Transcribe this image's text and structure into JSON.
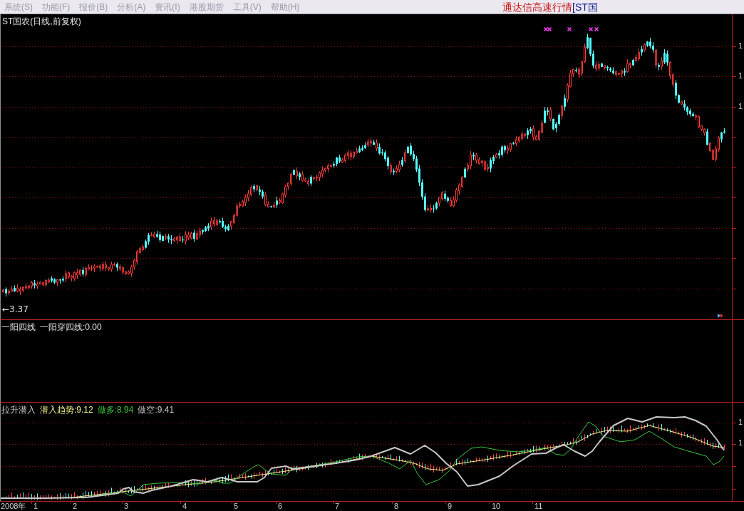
{
  "menu_bar": {
    "items": [
      "系统(S)",
      "功能(F)",
      "报价(B)",
      "分析(A)",
      "资讯(I)",
      "港股期货",
      "工具(V)",
      "帮助(H)"
    ],
    "app_title": "通达信高速行情",
    "stock_title": "[ST国"
  },
  "price_panel": {
    "title": "ST国农(日线,前复权)",
    "low_label": "←3.37",
    "axis_labels": [
      "1",
      "1",
      "1"
    ]
  },
  "indicator_panel": {
    "name": "一阳四线",
    "readout": "一阳穿四线:0.00"
  },
  "oscillator_panel": {
    "name": "拉升潜入",
    "series": [
      {
        "label": "潜入趋势:9.12",
        "color": "#f0f08c"
      },
      {
        "label": "做多:8.94",
        "color": "#3cc83c"
      },
      {
        "label": "做空:9.41",
        "color": "#c8c8c8"
      }
    ],
    "axis_labels": [
      "1",
      "1"
    ]
  },
  "time_axis": {
    "labels": [
      "2008年",
      "1",
      "2",
      "3",
      "4",
      "5",
      "6",
      "7",
      "8",
      "9",
      "10",
      "11"
    ]
  }
}
